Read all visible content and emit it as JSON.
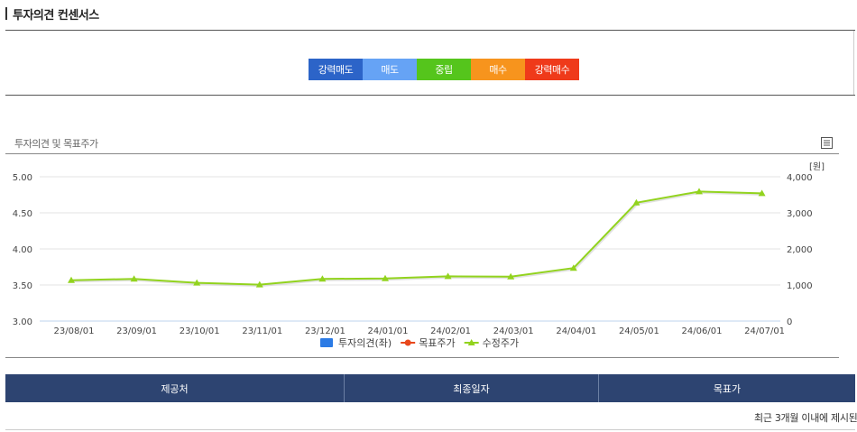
{
  "header": {
    "title": "투자의견 컨센서스"
  },
  "opinion_scale": {
    "items": [
      {
        "label": "강력매도",
        "color": "#2c64c8"
      },
      {
        "label": "매도",
        "color": "#66a3f5"
      },
      {
        "label": "중립",
        "color": "#55c51c"
      },
      {
        "label": "매수",
        "color": "#f7941d"
      },
      {
        "label": "강력매수",
        "color": "#ef3a1a"
      }
    ]
  },
  "chart_section": {
    "title": "투자의견 및 목표주가",
    "icon": "list-icon"
  },
  "chart_data": {
    "type": "line",
    "categories": [
      "23/08/01",
      "23/09/01",
      "23/10/01",
      "23/11/01",
      "23/12/01",
      "24/01/01",
      "24/02/01",
      "24/03/01",
      "24/04/01",
      "24/05/01",
      "24/06/01",
      "24/07/01"
    ],
    "y_left": {
      "ticks": [
        "3.00",
        "3.50",
        "4.00",
        "4.50",
        "5.00"
      ],
      "range": [
        3.0,
        5.0
      ]
    },
    "y_right": {
      "ticks": [
        "0",
        "1,000",
        "2,000",
        "3,000",
        "4,000"
      ],
      "range": [
        0,
        4000
      ],
      "unit": "[원]"
    },
    "series": [
      {
        "name": "투자의견(좌)",
        "axis": "left",
        "color": "#2c7be5",
        "marker": "square",
        "values": []
      },
      {
        "name": "목표주가",
        "axis": "right",
        "color": "#e8481c",
        "marker": "circle",
        "values": []
      },
      {
        "name": "수정주가",
        "axis": "right",
        "color": "#92d31e",
        "marker": "triangle",
        "values": [
          1130,
          1170,
          1060,
          1010,
          1170,
          1180,
          1240,
          1230,
          1470,
          3280,
          3590,
          3540
        ]
      }
    ],
    "grid": true,
    "legend": "bottom"
  },
  "table": {
    "headers": [
      "제공처",
      "최종일자",
      "목표가"
    ],
    "notice": "최근 3개월 이내에 제시된"
  }
}
